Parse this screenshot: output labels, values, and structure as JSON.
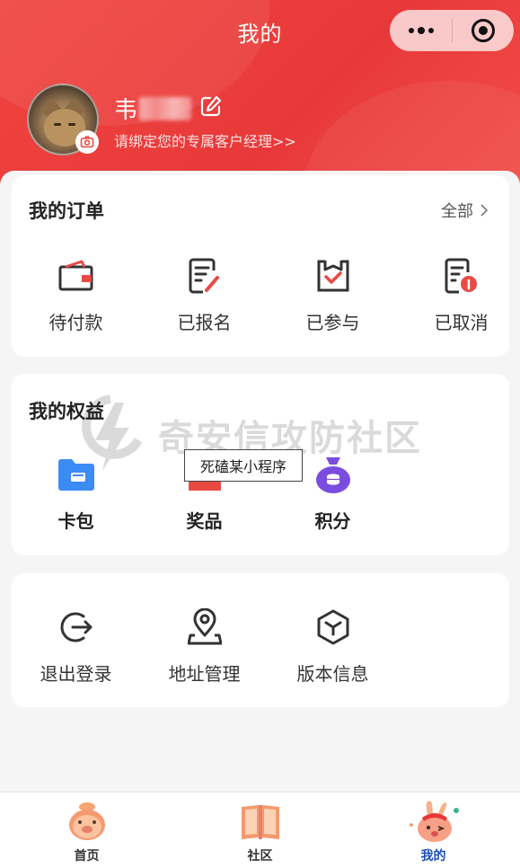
{
  "header": {
    "title": "我的"
  },
  "profile": {
    "name_visible": "韦",
    "subtitle": "请绑定您的专属客户经理>>"
  },
  "orders": {
    "title": "我的订单",
    "all_label": "全部",
    "items": [
      {
        "label": "待付款",
        "icon": "wallet-icon"
      },
      {
        "label": "已报名",
        "icon": "signup-form-icon"
      },
      {
        "label": "已参与",
        "icon": "checked-box-icon"
      },
      {
        "label": "已取消",
        "icon": "cancelled-doc-icon"
      }
    ]
  },
  "benefits": {
    "title": "我的权益",
    "items": [
      {
        "label": "卡包",
        "icon": "card-folder-icon"
      },
      {
        "label": "奖品",
        "icon": "prize-icon"
      },
      {
        "label": "积分",
        "icon": "points-bag-icon"
      }
    ]
  },
  "tools": {
    "items": [
      {
        "label": "退出登录",
        "icon": "logout-icon"
      },
      {
        "label": "地址管理",
        "icon": "location-icon"
      },
      {
        "label": "版本信息",
        "icon": "version-box-icon"
      }
    ]
  },
  "watermark": {
    "text": "奇安信攻防社区"
  },
  "tooltip": {
    "text": "死磕某小程序"
  },
  "tabbar": {
    "items": [
      {
        "label": "首页",
        "active": false
      },
      {
        "label": "社区",
        "active": false
      },
      {
        "label": "我的",
        "active": true
      }
    ]
  },
  "colors": {
    "brand_red": "#e8393a",
    "icon_red": "#e84a43",
    "card_blue": "#3d8bf5",
    "points_purple": "#7a4de0",
    "active_tab": "#1a4fb8"
  }
}
